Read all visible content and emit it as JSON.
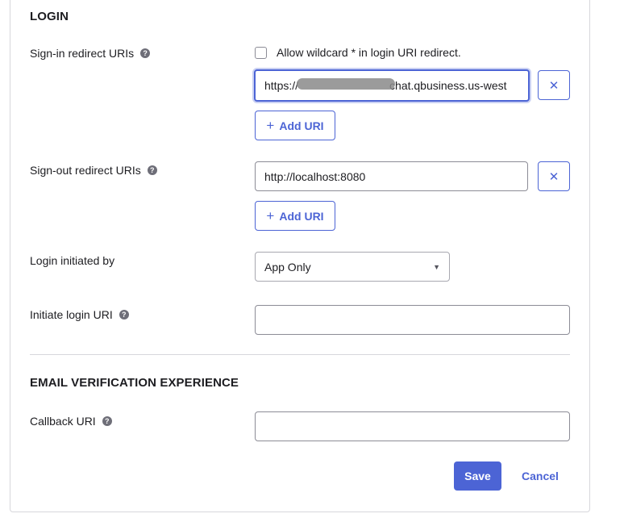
{
  "login": {
    "section_title": "LOGIN",
    "signin": {
      "label": "Sign-in redirect URIs",
      "wildcard_label": "Allow wildcard * in login URI redirect.",
      "uri_prefix": "https://",
      "uri_suffix": "chat.qbusiness.us-west",
      "add_label": "Add URI"
    },
    "signout": {
      "label": "Sign-out redirect URIs",
      "uri_value": "http://localhost:8080",
      "add_label": "Add URI"
    },
    "initiated_by": {
      "label": "Login initiated by",
      "selected": "App Only"
    },
    "initiate_uri": {
      "label": "Initiate login URI",
      "value": ""
    }
  },
  "email": {
    "section_title": "EMAIL VERIFICATION EXPERIENCE",
    "callback": {
      "label": "Callback URI",
      "value": ""
    }
  },
  "actions": {
    "save_label": "Save",
    "cancel_label": "Cancel"
  },
  "icons": {
    "help": "?",
    "remove": "✕",
    "add": "+",
    "caret": "▼"
  },
  "colors": {
    "accent": "#4c64d5"
  }
}
